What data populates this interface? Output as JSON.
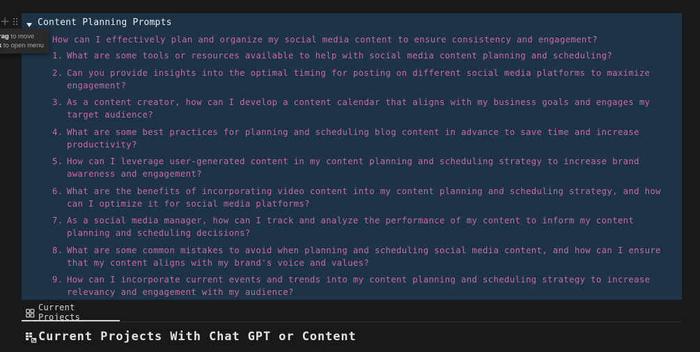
{
  "block_controls": {
    "plus_icon": "plus-icon",
    "drag_icon": "drag-handle-icon"
  },
  "tooltip": {
    "drag_keyword": "rag",
    "drag_text": " to move",
    "click_keyword": "k",
    "click_text": " to open menu"
  },
  "toggle": {
    "title": "Content Planning Prompts",
    "icon": "triangle-down-icon",
    "intro": "How can I effectively plan and organize my social media content to ensure consistency and engagement?",
    "items": [
      {
        "num": "1.",
        "text": "What are some tools or resources available to help with social media content planning and scheduling?"
      },
      {
        "num": "2.",
        "text": "Can you provide insights into the optimal timing for posting on different social media platforms to maximize engagement?"
      },
      {
        "num": "3.",
        "text": "As a content creator, how can I develop a content calendar that aligns with my business goals and engages my target audience?"
      },
      {
        "num": "4.",
        "text": "What are some best practices for planning and scheduling blog content in advance to save time and increase productivity?"
      },
      {
        "num": "5.",
        "text": "How can I leverage user-generated content in my content planning and scheduling strategy to increase brand awareness and engagement?"
      },
      {
        "num": "6.",
        "text": "What are the benefits of incorporating video content into my content planning and scheduling strategy, and how can I optimize it for social media platforms?"
      },
      {
        "num": "7.",
        "text": "As a social media manager, how can I track and analyze the performance of my content to inform my content planning and scheduling decisions?"
      },
      {
        "num": "8.",
        "text": "What are some common mistakes to avoid when planning and scheduling social media content, and how can I ensure that my content aligns with my brand's voice and values?"
      },
      {
        "num": "9.",
        "text": "How can I incorporate current events and trends into my content planning and scheduling strategy to increase relevancy and engagement with my audience?"
      }
    ]
  },
  "tab": {
    "label": "Current Projects",
    "icon": "gallery-view-icon"
  },
  "section": {
    "heading": "Current Projects With Chat GPT or Content",
    "icon": "linked-database-icon"
  },
  "colors": {
    "background": "#191919",
    "callout_bg": "#1d3346",
    "pink_text": "#c86aa3",
    "title_text": "#e9eef3"
  }
}
